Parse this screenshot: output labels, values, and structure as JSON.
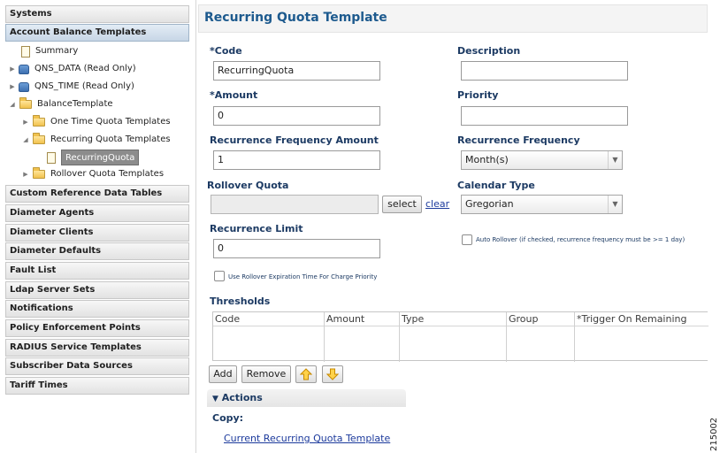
{
  "sidebar": {
    "headers_top": [
      {
        "label": "Systems"
      },
      {
        "label": "Account Balance Templates"
      }
    ],
    "tree": {
      "summary": "Summary",
      "qns_data": "QNS_DATA (Read Only)",
      "qns_time": "QNS_TIME (Read Only)",
      "balance_template": "BalanceTemplate",
      "one_time": "One Time Quota Templates",
      "recurring": "Recurring Quota Templates",
      "recurring_quota": "RecurringQuota",
      "rollover": "Rollover Quota Templates"
    },
    "headers_bottom": [
      {
        "label": "Custom Reference Data Tables"
      },
      {
        "label": "Diameter Agents"
      },
      {
        "label": "Diameter Clients"
      },
      {
        "label": "Diameter Defaults"
      },
      {
        "label": "Fault List"
      },
      {
        "label": "Ldap Server Sets"
      },
      {
        "label": "Notifications"
      },
      {
        "label": "Policy Enforcement Points"
      },
      {
        "label": "RADIUS Service Templates"
      },
      {
        "label": "Subscriber Data Sources"
      },
      {
        "label": "Tariff Times"
      }
    ]
  },
  "main": {
    "title": "Recurring Quota Template",
    "fields": {
      "code_label": "*Code",
      "code_value": "RecurringQuota",
      "description_label": "Description",
      "description_value": "",
      "amount_label": "*Amount",
      "amount_value": "0",
      "priority_label": "Priority",
      "priority_value": "",
      "rec_freq_amount_label": "Recurrence Frequency Amount",
      "rec_freq_amount_value": "1",
      "rec_freq_label": "Recurrence Frequency",
      "rec_freq_value": "Month(s)",
      "rollover_label": "Rollover Quota",
      "rollover_value": "",
      "select_label": "select",
      "clear_label": "clear",
      "calendar_label": "Calendar Type",
      "calendar_value": "Gregorian",
      "rec_limit_label": "Recurrence Limit",
      "rec_limit_value": "0",
      "auto_rollover_label": "Auto Rollover (if checked, recurrence frequency must be >= 1 day)",
      "use_rollover_label": "Use Rollover Expiration Time For Charge Priority"
    },
    "thresholds": {
      "label": "Thresholds",
      "columns": [
        "Code",
        "Amount",
        "Type",
        "Group",
        "*Trigger On Remaining"
      ],
      "buttons": {
        "add": "Add",
        "remove": "Remove"
      }
    },
    "actions": {
      "title": "Actions",
      "copy_label": "Copy:",
      "copy_link": "Current Recurring Quota Template"
    },
    "figure_number": "215002"
  },
  "colors": {
    "title": "#1d5a8e",
    "label": "#1c3a63",
    "link": "#1c3a9c",
    "selected_item": "#8c8c8c"
  }
}
